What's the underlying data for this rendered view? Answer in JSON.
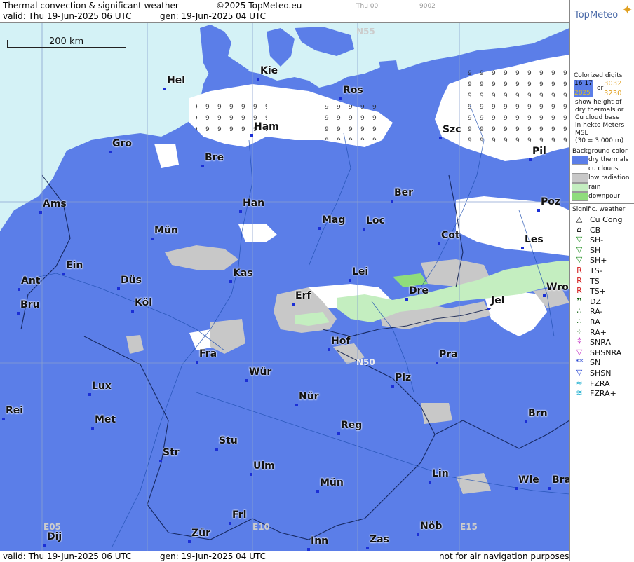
{
  "header": {
    "title": "Thermal convection & significant weather",
    "copyright": "©2025 TopMeteo.eu",
    "valid": "valid:  Thu  19-Jun-2025  06 UTC",
    "gen": "gen: 19-Jun-2025 04 UTC",
    "small1": "Thu 00",
    "small2": "9002",
    "brand": "TopMeteo"
  },
  "footer": {
    "valid": "valid:  Thu  19-Jun-2025  06 UTC",
    "gen": "gen: 19-Jun-2025 04 UTC",
    "note": "not for air navigation purposes"
  },
  "scale_label": "200 km",
  "grid_labels": [
    "N55",
    "N50",
    "E05",
    "E10",
    "E15"
  ],
  "legend": {
    "colorized_title": "Colorized digits",
    "digit_samples": [
      "16 17",
      "3032",
      "or",
      "2825",
      "3230"
    ],
    "desc": [
      "show height of",
      "dry thermals or",
      "Cu cloud base",
      "in hekto Meters",
      "MSL",
      "(30 = 3.000 m)"
    ],
    "bg_title": "Background color",
    "bg_items": [
      {
        "label": "dry thermals",
        "color": "#5b7ee8"
      },
      {
        "label": "cu clouds",
        "color": "#ffffff"
      },
      {
        "label": "low radiation",
        "color": "#c8c8c8"
      },
      {
        "label": "rain",
        "color": "#c4eec0"
      },
      {
        "label": "downpour",
        "color": "#8fdc7c"
      }
    ],
    "wx_title": "Signific. weather",
    "wx_items": [
      {
        "label": "Cu Cong",
        "icon": "cu-cong-icon",
        "glyph": "△",
        "color": "#000"
      },
      {
        "label": "CB",
        "icon": "cb-icon",
        "glyph": "⌂",
        "color": "#000"
      },
      {
        "label": "SH-",
        "icon": "shower-light-icon",
        "glyph": "▽",
        "color": "#1a8a1a"
      },
      {
        "label": "SH",
        "icon": "shower-icon",
        "glyph": "▽",
        "color": "#1a8a1a"
      },
      {
        "label": "SH+",
        "icon": "shower-heavy-icon",
        "glyph": "▽",
        "color": "#1a8a1a"
      },
      {
        "label": "TS-",
        "icon": "thunderstorm-light-icon",
        "glyph": "R",
        "color": "#d42020"
      },
      {
        "label": "TS",
        "icon": "thunderstorm-icon",
        "glyph": "R",
        "color": "#d42020"
      },
      {
        "label": "TS+",
        "icon": "thunderstorm-heavy-icon",
        "glyph": "R",
        "color": "#d42020"
      },
      {
        "label": "DZ",
        "icon": "drizzle-icon",
        "glyph": "❜❜",
        "color": "#0a5a0a"
      },
      {
        "label": "RA-",
        "icon": "rain-light-icon",
        "glyph": "∴",
        "color": "#0a5a0a"
      },
      {
        "label": "RA",
        "icon": "rain-icon",
        "glyph": "∴",
        "color": "#0a5a0a"
      },
      {
        "label": "RA+",
        "icon": "rain-heavy-icon",
        "glyph": "⁘",
        "color": "#0a5a0a"
      },
      {
        "label": "SNRA",
        "icon": "sleet-icon",
        "glyph": "⁑",
        "color": "#c020c0"
      },
      {
        "label": "SHSNRA",
        "icon": "sleet-shower-icon",
        "glyph": "▽",
        "color": "#c020c0"
      },
      {
        "label": "SN",
        "icon": "snow-icon",
        "glyph": "**",
        "color": "#2040d0"
      },
      {
        "label": "SHSN",
        "icon": "snow-shower-icon",
        "glyph": "▽",
        "color": "#2040d0"
      },
      {
        "label": "FZRA",
        "icon": "freezing-rain-icon",
        "glyph": "≈",
        "color": "#20b0d0"
      },
      {
        "label": "FZRA+",
        "icon": "freezing-rain-heavy-icon",
        "glyph": "≋",
        "color": "#20b0d0"
      }
    ]
  },
  "cities": [
    {
      "name": "Hel"
    },
    {
      "name": "Kie"
    },
    {
      "name": "Ros"
    },
    {
      "name": "Gro"
    },
    {
      "name": "Ham"
    },
    {
      "name": "Szc"
    },
    {
      "name": "Bre"
    },
    {
      "name": "Pil"
    },
    {
      "name": "Ber"
    },
    {
      "name": "Ams"
    },
    {
      "name": "Han"
    },
    {
      "name": "Poz"
    },
    {
      "name": "Mün"
    },
    {
      "name": "Mag"
    },
    {
      "name": "Loc"
    },
    {
      "name": "Cot"
    },
    {
      "name": "Les"
    },
    {
      "name": "Ein"
    },
    {
      "name": "Kas"
    },
    {
      "name": "Lei"
    },
    {
      "name": "Ant"
    },
    {
      "name": "Düs"
    },
    {
      "name": "Dre"
    },
    {
      "name": "Wro"
    },
    {
      "name": "Erf"
    },
    {
      "name": "Bru"
    },
    {
      "name": "Köl"
    },
    {
      "name": "Jel"
    },
    {
      "name": "Hof"
    },
    {
      "name": "Fra"
    },
    {
      "name": "Pra"
    },
    {
      "name": "Wür"
    },
    {
      "name": "Plz"
    },
    {
      "name": "Lux"
    },
    {
      "name": "Nür"
    },
    {
      "name": "Rei"
    },
    {
      "name": "Met"
    },
    {
      "name": "Reg"
    },
    {
      "name": "Brn"
    },
    {
      "name": "Stu"
    },
    {
      "name": "Str"
    },
    {
      "name": "Ulm"
    },
    {
      "name": "Lin"
    },
    {
      "name": "Mün"
    },
    {
      "name": "Wie"
    },
    {
      "name": "Bra"
    },
    {
      "name": "Fri"
    },
    {
      "name": "Nöb"
    },
    {
      "name": "Dij"
    },
    {
      "name": "Zür"
    },
    {
      "name": "Inn"
    },
    {
      "name": "Zas"
    }
  ],
  "colors": {
    "sea": "#d4f2f6",
    "dry_thermals": "#5b7ee8",
    "cu_clouds": "#ffffff",
    "low_radiation": "#c8c8c8",
    "rain": "#c4eec0",
    "city_dot": "#1b2fd6"
  }
}
